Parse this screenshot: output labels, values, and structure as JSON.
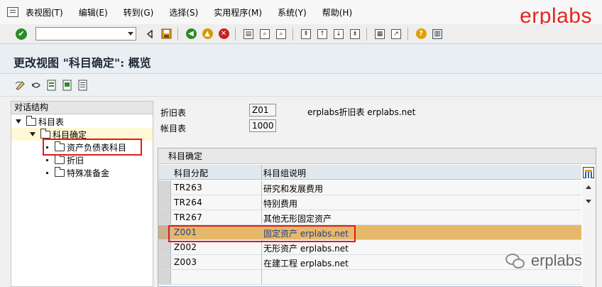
{
  "menu": {
    "items": [
      "表视图(T)",
      "编辑(E)",
      "转到(G)",
      "选择(S)",
      "实用程序(M)",
      "系统(Y)",
      "帮助(H)"
    ],
    "brand": "erplabs"
  },
  "toolbar": {
    "command_value": "",
    "icons": [
      "check-icon",
      "back-icon",
      "save-icon",
      "back-green-icon",
      "exit-icon",
      "cancel-icon",
      "print-icon",
      "find-icon",
      "find-next-icon",
      "first-page-icon",
      "prev-page-icon",
      "next-page-icon",
      "last-page-icon",
      "new-session-icon",
      "shortcut-icon",
      "help-icon",
      "layout-icon"
    ]
  },
  "page": {
    "title": "更改视图 \"科目确定\": 概览"
  },
  "tree": {
    "header": "对话结构",
    "nodes": [
      {
        "label": "科目表",
        "level": 0,
        "expanded": true
      },
      {
        "label": "科目确定",
        "level": 1,
        "expanded": true
      },
      {
        "label": "资产负债表科目",
        "level": 2,
        "selected": true
      },
      {
        "label": "折旧",
        "level": 2
      },
      {
        "label": "特殊准备金",
        "level": 2
      }
    ]
  },
  "fields": {
    "depr_area_label": "折旧表",
    "depr_area_value": "Z01",
    "depr_area_desc": "erplabs折旧表 erplabs.net",
    "coa_label": "帐目表",
    "coa_value": "1000"
  },
  "table": {
    "title": "科目确定",
    "headers": [
      "科目分配",
      "科目组说明"
    ],
    "rows": [
      {
        "code": "TR263",
        "desc": "研究和发展费用"
      },
      {
        "code": "TR264",
        "desc": "特别费用"
      },
      {
        "code": "TR267",
        "desc": "其他无形固定资产"
      },
      {
        "code": "Z001",
        "desc": "固定资产 erplabs.net",
        "highlight": true
      },
      {
        "code": "Z002",
        "desc": "无形资产 erplabs.net"
      },
      {
        "code": "Z003",
        "desc": "在建工程 erplabs.net"
      },
      {
        "code": "",
        "desc": ""
      }
    ]
  },
  "watermark": {
    "text": "erplabs"
  },
  "colors": {
    "brand_red": "#e6261f",
    "highlight_row": "#e6b86a",
    "annotation_red": "#e21b1b"
  }
}
